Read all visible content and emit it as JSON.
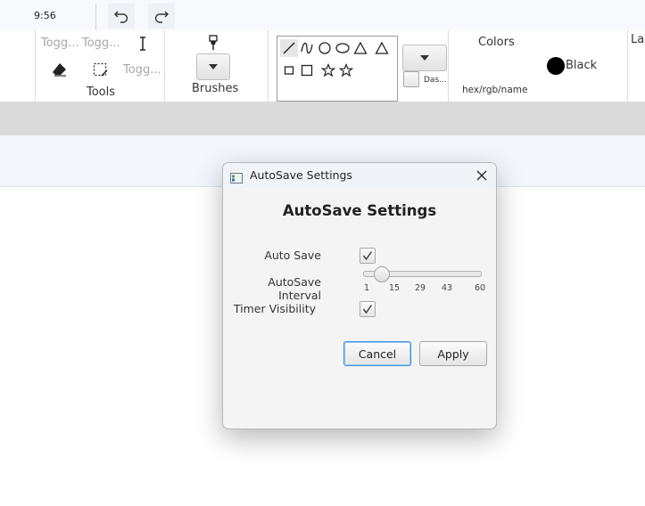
{
  "quickbar": {
    "time": "9:56"
  },
  "ribbon": {
    "tools": {
      "toggle1": "Togg...",
      "toggle2": "Togg...",
      "toggle3": "Togg...",
      "label": "Tools"
    },
    "brushes": {
      "label": "Brushes"
    },
    "dash_label": "Das...",
    "colors": {
      "title": "Colors",
      "field_placeholder": "hex/rgb/name",
      "current": "Black",
      "current_hex": "#000000"
    },
    "layers_label": "Lay"
  },
  "dialog": {
    "window_title": "AutoSave Settings",
    "heading": "AutoSave Settings",
    "auto_save_label": "Auto Save",
    "auto_save_checked": true,
    "interval_label": "AutoSave Interval",
    "interval_value": 5,
    "interval_min": 1,
    "interval_max": 60,
    "interval_ticks": [
      "1",
      "15",
      "29",
      "43",
      "60"
    ],
    "timer_label": "Timer Visibility",
    "timer_checked": true,
    "cancel_label": "Cancel",
    "apply_label": "Apply"
  }
}
